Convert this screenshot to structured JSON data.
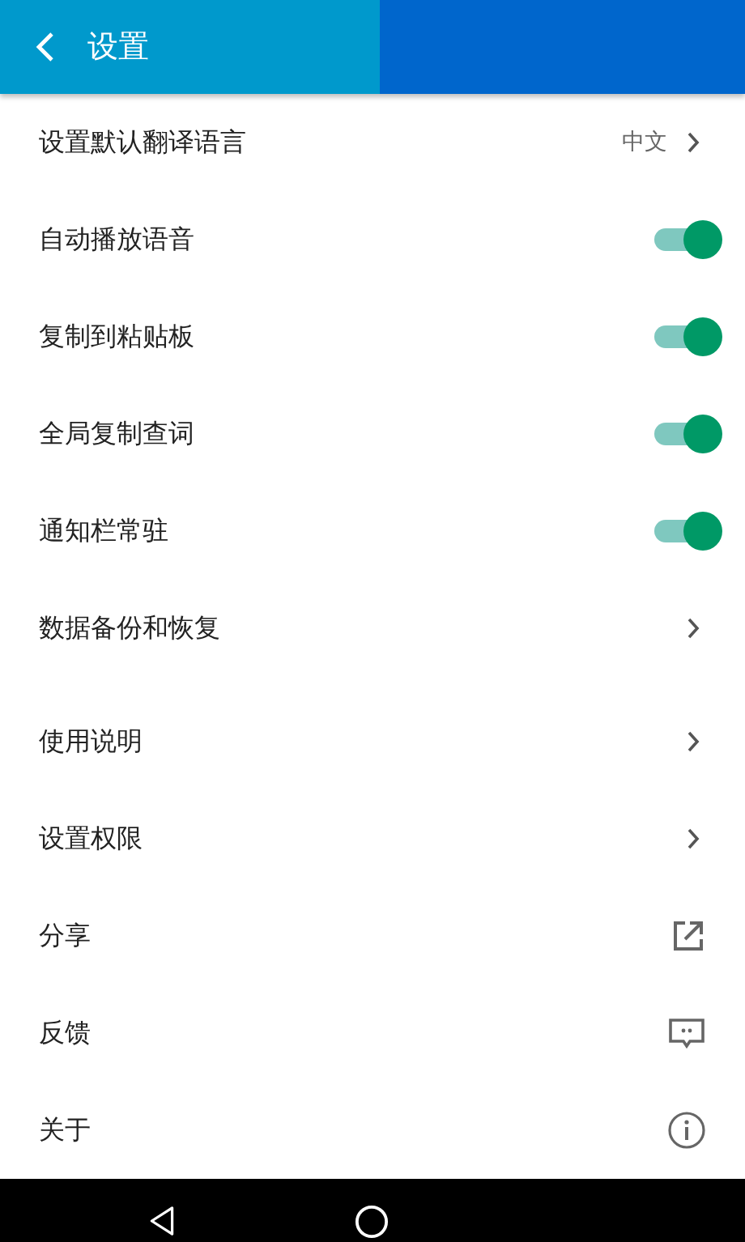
{
  "app_bar": {
    "title": "设置"
  },
  "sections": [
    {
      "items": [
        {
          "label": "设置默认翻译语言",
          "kind": "value",
          "value": "中文"
        },
        {
          "label": "自动播放语音",
          "kind": "toggle",
          "on": true
        },
        {
          "label": "复制到粘贴板",
          "kind": "toggle",
          "on": true
        },
        {
          "label": "全局复制查词",
          "kind": "toggle",
          "on": true
        },
        {
          "label": "通知栏常驻",
          "kind": "toggle",
          "on": true
        },
        {
          "label": "数据备份和恢复",
          "kind": "link"
        }
      ]
    },
    {
      "items": [
        {
          "label": "使用说明",
          "kind": "link"
        },
        {
          "label": "设置权限",
          "kind": "link"
        },
        {
          "label": "分享",
          "kind": "share"
        },
        {
          "label": "反馈",
          "kind": "feedback"
        },
        {
          "label": "关于",
          "kind": "info"
        }
      ]
    }
  ]
}
